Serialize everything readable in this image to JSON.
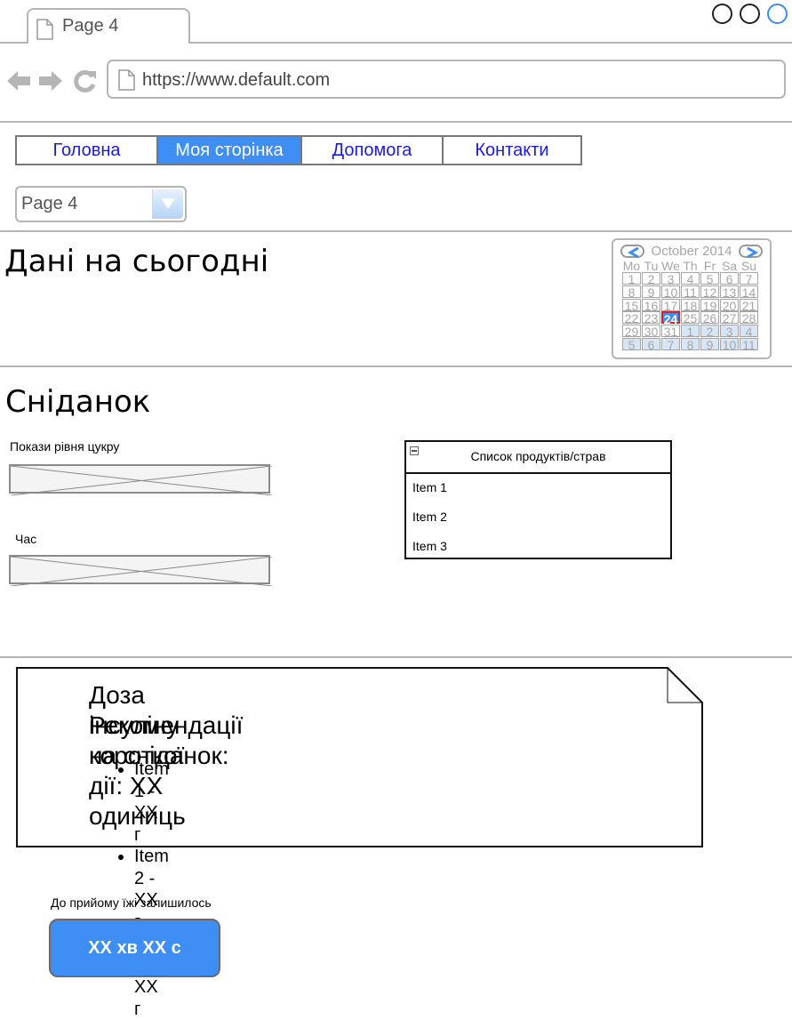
{
  "browser": {
    "tab_title": "Page 4",
    "url": "https://www.default.com",
    "icons": [
      "page-icon",
      "back-arrow-icon",
      "forward-arrow-icon",
      "reload-icon",
      "window-buttons"
    ]
  },
  "nav_menu": {
    "items": [
      {
        "label": "Головна",
        "active": false
      },
      {
        "label": "Моя сторінка",
        "active": true
      },
      {
        "label": "Допомога",
        "active": false
      },
      {
        "label": "Контакти",
        "active": false
      }
    ]
  },
  "page_select": {
    "value": "Page 4"
  },
  "today_section": {
    "title": "Дані на сьогодні"
  },
  "calendar": {
    "month_label": "October 2014",
    "weekdays": [
      "Mo",
      "Tu",
      "We",
      "Th",
      "Fr",
      "Sa",
      "Su"
    ],
    "weeks": [
      [
        "1",
        "2",
        "3",
        "4",
        "5",
        "6",
        "7"
      ],
      [
        "8",
        "9",
        "10",
        "11",
        "12",
        "13",
        "14"
      ],
      [
        "15",
        "16",
        "17",
        "18",
        "19",
        "20",
        "21"
      ],
      [
        "22",
        "23",
        "24",
        "25",
        "26",
        "27",
        "28"
      ],
      [
        "29",
        "30",
        "31",
        "1",
        "2",
        "3",
        "4"
      ],
      [
        "5",
        "6",
        "7",
        "8",
        "9",
        "10",
        "11"
      ]
    ],
    "selected_day": "24"
  },
  "breakfast": {
    "title": "Сніданок",
    "sugar_label": "Покази рівня цукру",
    "time_label": "Час",
    "products_list": {
      "title": "Список  продуктів/страв",
      "items": [
        "Item 1",
        "Item 2",
        "Item 3"
      ]
    }
  },
  "note": {
    "dose_line": "Доза інсуліну короткої дії: XX одиниць",
    "recommendations_line": "Рекомендації на сніданок:",
    "items": [
      "Item 1 - XX г",
      "Item 2 - XX г",
      "Item 3 - XX г"
    ]
  },
  "countdown": {
    "label": "До прийому їжі залишилось",
    "value": "XX хв XX с"
  },
  "colors": {
    "accent_blue": "#3e8ef5",
    "link_blue": "#1a1ae6",
    "today_border": "#e02020",
    "chrome_gray": "#b5b5b5"
  }
}
